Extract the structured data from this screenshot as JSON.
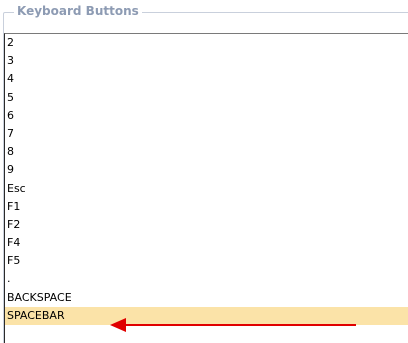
{
  "group": {
    "title": "Keyboard Buttons"
  },
  "list": {
    "items": [
      {
        "label": "2",
        "selected": false
      },
      {
        "label": "3",
        "selected": false
      },
      {
        "label": "4",
        "selected": false
      },
      {
        "label": "5",
        "selected": false
      },
      {
        "label": "6",
        "selected": false
      },
      {
        "label": "7",
        "selected": false
      },
      {
        "label": "8",
        "selected": false
      },
      {
        "label": "9",
        "selected": false
      },
      {
        "label": "Esc",
        "selected": false
      },
      {
        "label": "F1",
        "selected": false
      },
      {
        "label": "F2",
        "selected": false
      },
      {
        "label": "F4",
        "selected": false
      },
      {
        "label": "F5",
        "selected": false
      },
      {
        "label": ".",
        "selected": false
      },
      {
        "label": "BACKSPACE",
        "selected": false
      },
      {
        "label": "SPACEBAR",
        "selected": true
      }
    ]
  },
  "colors": {
    "selection_background": "#fbe3a8",
    "annotation_arrow": "#e00000",
    "legend_text": "#8d9bb3"
  },
  "annotation": {
    "icon": "left-arrow-icon"
  }
}
